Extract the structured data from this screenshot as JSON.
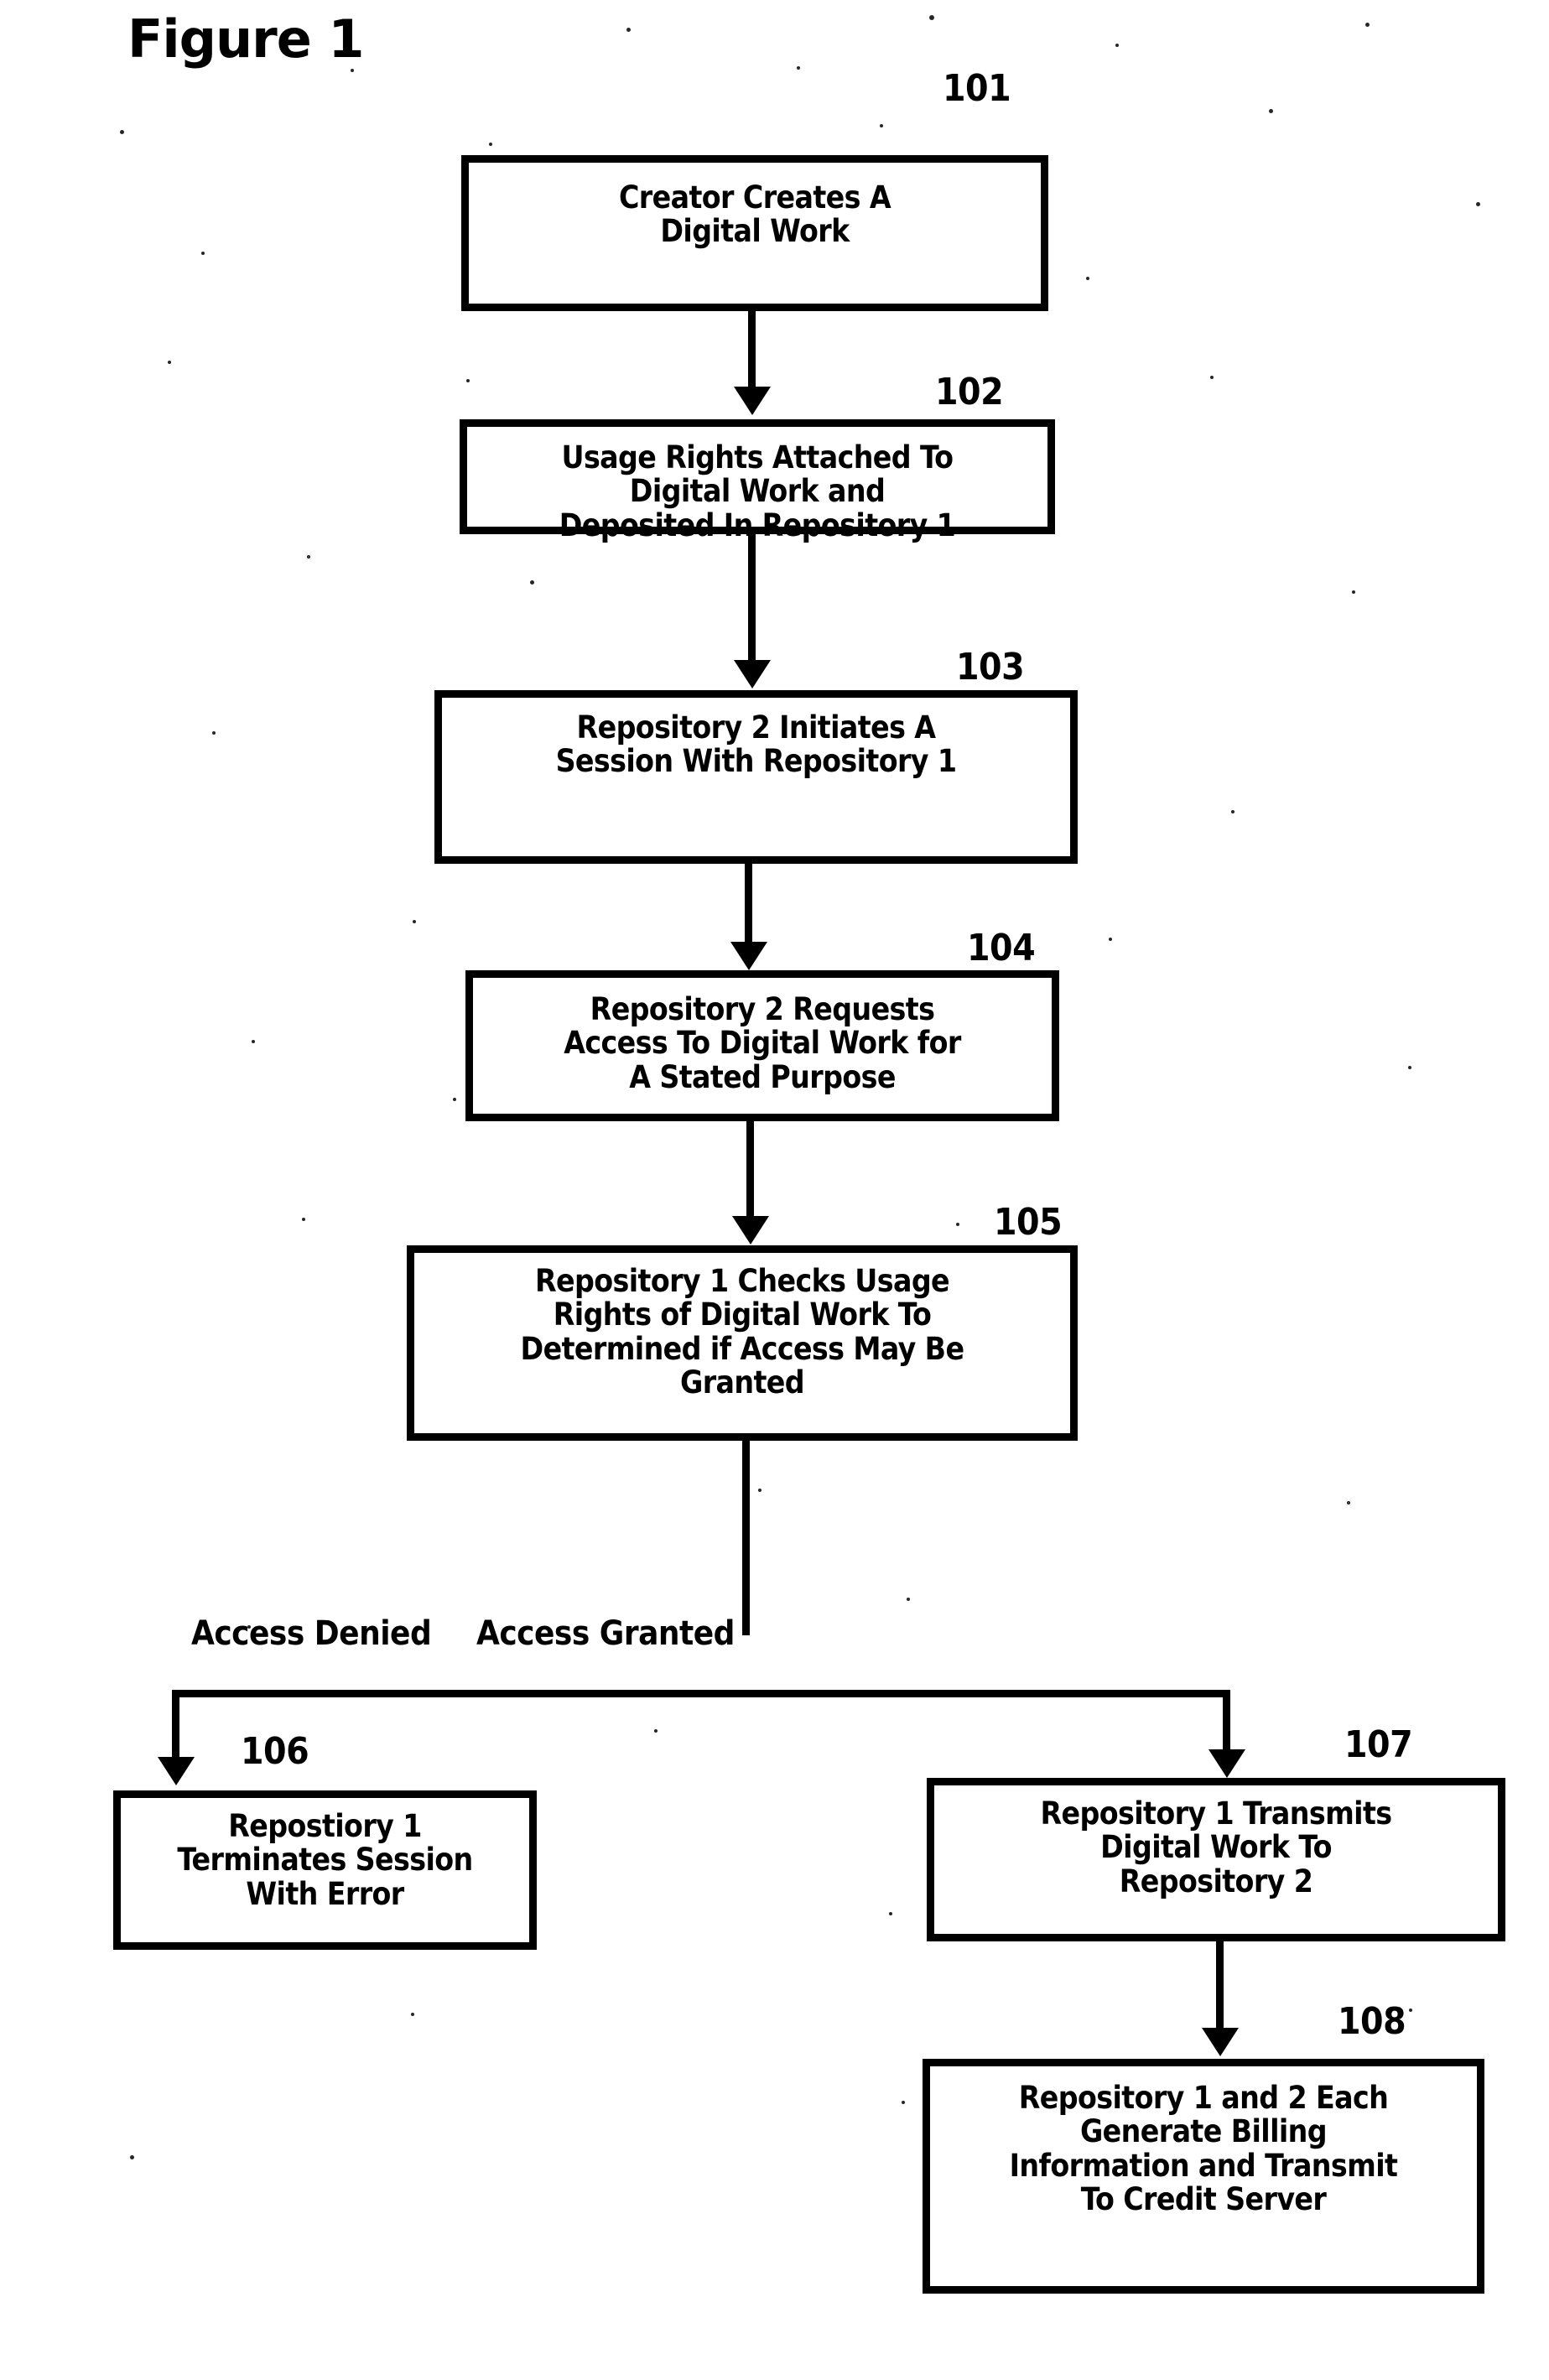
{
  "figure": {
    "title": "Figure 1"
  },
  "flowchart": {
    "type": "patent-flowchart",
    "nodes": [
      {
        "ref": "101",
        "text": "Creator Creates A\nDigital Work"
      },
      {
        "ref": "102",
        "text": "Usage Rights Attached To\nDigital Work and\nDeposited In Repository 1"
      },
      {
        "ref": "103",
        "text": "Repository 2 Initiates A\nSession With Repository 1"
      },
      {
        "ref": "104",
        "text": "Repository 2 Requests\nAccess To Digital Work for\nA Stated Purpose"
      },
      {
        "ref": "105",
        "text": "Repository 1 Checks Usage\nRights of Digital Work To\nDetermined if Access May Be\nGranted"
      },
      {
        "ref": "106",
        "text": "Repostiory 1\nTerminates Session\nWith Error"
      },
      {
        "ref": "107",
        "text": "Repository 1 Transmits\nDigital Work To\nRepository 2"
      },
      {
        "ref": "108",
        "text": "Repository 1 and 2 Each\nGenerate Billing\nInformation and Transmit\nTo Credit Server"
      }
    ],
    "branch_labels": {
      "denied": "Access Denied",
      "granted": "Access Granted"
    },
    "edges": [
      {
        "from": "101",
        "to": "102",
        "label": ""
      },
      {
        "from": "102",
        "to": "103",
        "label": ""
      },
      {
        "from": "103",
        "to": "104",
        "label": ""
      },
      {
        "from": "104",
        "to": "105",
        "label": ""
      },
      {
        "from": "105",
        "to": "106",
        "label": "Access Denied"
      },
      {
        "from": "105",
        "to": "107",
        "label": "Access Granted"
      },
      {
        "from": "107",
        "to": "108",
        "label": ""
      }
    ],
    "colors": {
      "ink": "#000000",
      "paper": "#ffffff"
    }
  }
}
